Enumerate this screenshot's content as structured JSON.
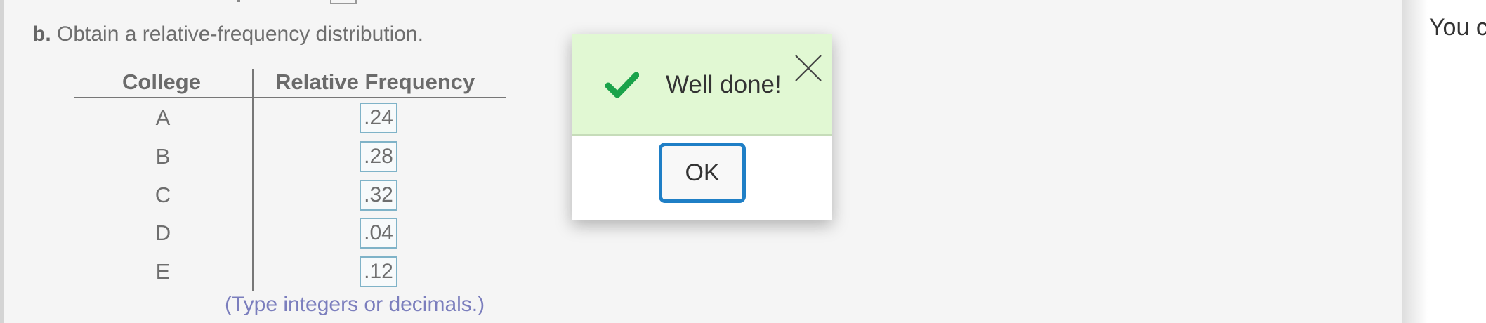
{
  "question": {
    "letter": "b.",
    "text": "Obtain a relative-frequency distribution."
  },
  "table": {
    "headers": [
      "College",
      "Relative Frequency"
    ],
    "rows": [
      {
        "label": "A",
        "value": ".24"
      },
      {
        "label": "B",
        "value": ".28"
      },
      {
        "label": "C",
        "value": ".32"
      },
      {
        "label": "D",
        "value": ".04"
      },
      {
        "label": "E",
        "value": ".12"
      }
    ]
  },
  "hint": "(Type integers or decimals.)",
  "dialog": {
    "message": "Well done!",
    "ok_label": "OK",
    "success_color": "#1aa34a",
    "accent_color": "#1f7fc6"
  },
  "side_panel": {
    "text": "You c"
  }
}
